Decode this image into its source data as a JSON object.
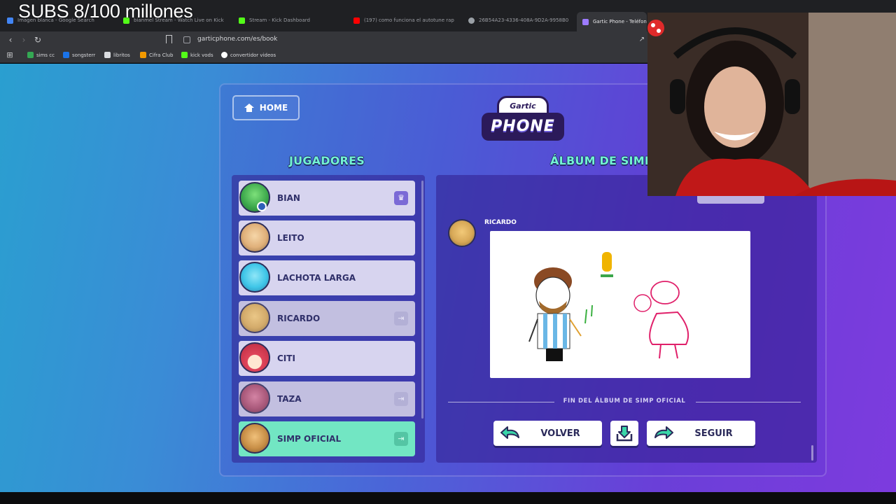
{
  "overlay": {
    "title": "SUBS 8/100 millones"
  },
  "browser": {
    "tabs": [
      {
        "label": "Imagen blanca - Google Search",
        "color": "#4285f4"
      },
      {
        "label": "bianmel Stream - Watch Live on Kick",
        "color": "#53fc18"
      },
      {
        "label": "Stream - Kick Dashboard",
        "color": "#53fc18"
      },
      {
        "label": "(197) como funciona el autotune rap",
        "color": "#ff0000"
      },
      {
        "label": "26B54A23-4336-408A-9D2A-9958B0",
        "color": "#9aa0a6"
      },
      {
        "label": "Gartic Phone - Teléfono",
        "color": "#9d7bff"
      }
    ],
    "url": "garticphone.com/es/book",
    "bookmarks": [
      {
        "label": "sims cc",
        "color": "#34a853"
      },
      {
        "label": "songsterr",
        "color": "#1a73e8"
      },
      {
        "label": "libritos",
        "color": "#dadce0"
      },
      {
        "label": "Cifra Club",
        "color": "#f29900"
      },
      {
        "label": "kick vods",
        "color": "#53fc18"
      },
      {
        "label": "convertidor videos",
        "color": "#ffffff"
      }
    ]
  },
  "game": {
    "home_label": "HOME",
    "logo": {
      "top": "Gartic",
      "bottom": "PHONE"
    },
    "players_title": "JUGADORES",
    "album_title": "ÁLBUM DE SIMP",
    "players": [
      {
        "name": "BIAN",
        "badge": "crown",
        "state": "normal",
        "avatar_color": "#4bd06a"
      },
      {
        "name": "LEITO",
        "badge": "",
        "state": "normal",
        "avatar_color": "#e8c08a"
      },
      {
        "name": "LACHOTA LARGA",
        "badge": "",
        "state": "normal",
        "avatar_color": "#3fc6e8"
      },
      {
        "name": "RICARDO",
        "badge": "exit",
        "state": "dim",
        "avatar_color": "#d7a857"
      },
      {
        "name": "CITI",
        "badge": "",
        "state": "normal",
        "avatar_color": "#e0455b"
      },
      {
        "name": "TAZA",
        "badge": "exit",
        "state": "dim",
        "avatar_color": "#a7496b"
      },
      {
        "name": "SIMP OFICIAL",
        "badge": "exit",
        "state": "active",
        "avatar_color": "#c88f47"
      }
    ],
    "author": "RICARDO",
    "album_end": "FIN DEL ÁLBUM DE SIMP OFICIAL",
    "buttons": {
      "back": "VOLVER",
      "next": "SEGUIR"
    },
    "accent_color": "#73f3d3"
  }
}
